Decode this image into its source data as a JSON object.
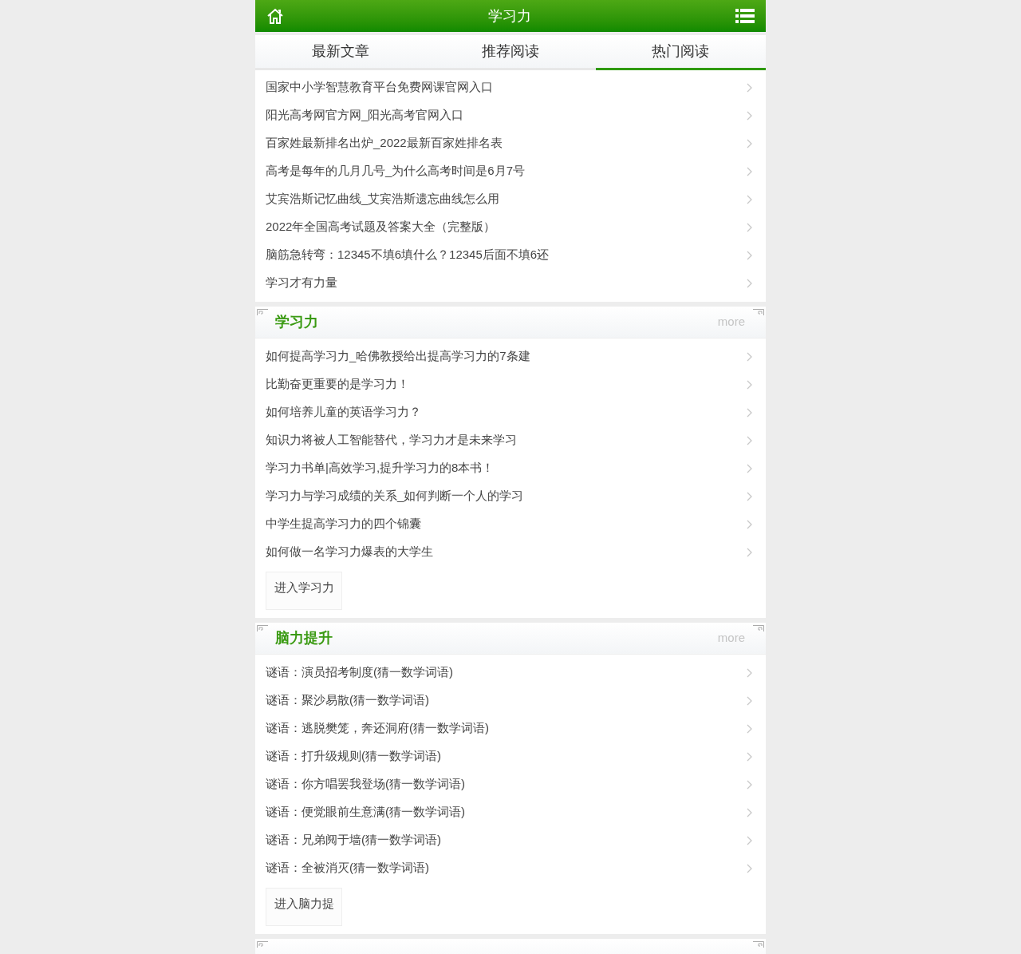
{
  "header": {
    "title": "学习力"
  },
  "tabs": [
    {
      "label": "最新文章",
      "selected": false
    },
    {
      "label": "推荐阅读",
      "selected": false
    },
    {
      "label": "热门阅读",
      "selected": true
    }
  ],
  "top_list": [
    "国家中小学智慧教育平台免费网课官网入口",
    "阳光高考网官方网_阳光高考官网入口",
    "百家姓最新排名出炉_2022最新百家姓排名表",
    "高考是每年的几月几号_为什么高考时间是6月7号",
    "艾宾浩斯记忆曲线_艾宾浩斯遗忘曲线怎么用",
    "2022年全国高考试题及答案大全（完整版）",
    "脑筋急转弯：12345不填6填什么？12345后面不填6还",
    "学习才有力量"
  ],
  "sections": [
    {
      "title": "学习力",
      "more": "more",
      "items": [
        "如何提高学习力_哈佛教授给出提高学习力的7条建",
        "比勤奋更重要的是学习力！",
        "如何培养儿童的英语学习力？",
        "知识力将被人工智能替代，学习力才是未来学习",
        "学习力书单|高效学习,提升学习力的8本书！",
        "学习力与学习成绩的关系_如何判断一个人的学习",
        "中学生提高学习力的四个锦囊",
        "如何做一名学习力爆表的大学生"
      ],
      "enter": "进入学习力"
    },
    {
      "title": "脑力提升",
      "more": "more",
      "items": [
        "谜语：演员招考制度(猜一数学词语)",
        "谜语：聚沙易散(猜一数学词语)",
        "谜语：逃脱樊笼，奔还洞府(猜一数学词语)",
        "谜语：打升级规则(猜一数学词语)",
        "谜语：你方唱罢我登场(猜一数学词语)",
        "谜语：便觉眼前生意满(猜一数学词语)",
        "谜语：兄弟阋于墙(猜一数学词语)",
        "谜语：全被消灭(猜一数学词语)"
      ],
      "enter": "进入脑力提"
    }
  ]
}
